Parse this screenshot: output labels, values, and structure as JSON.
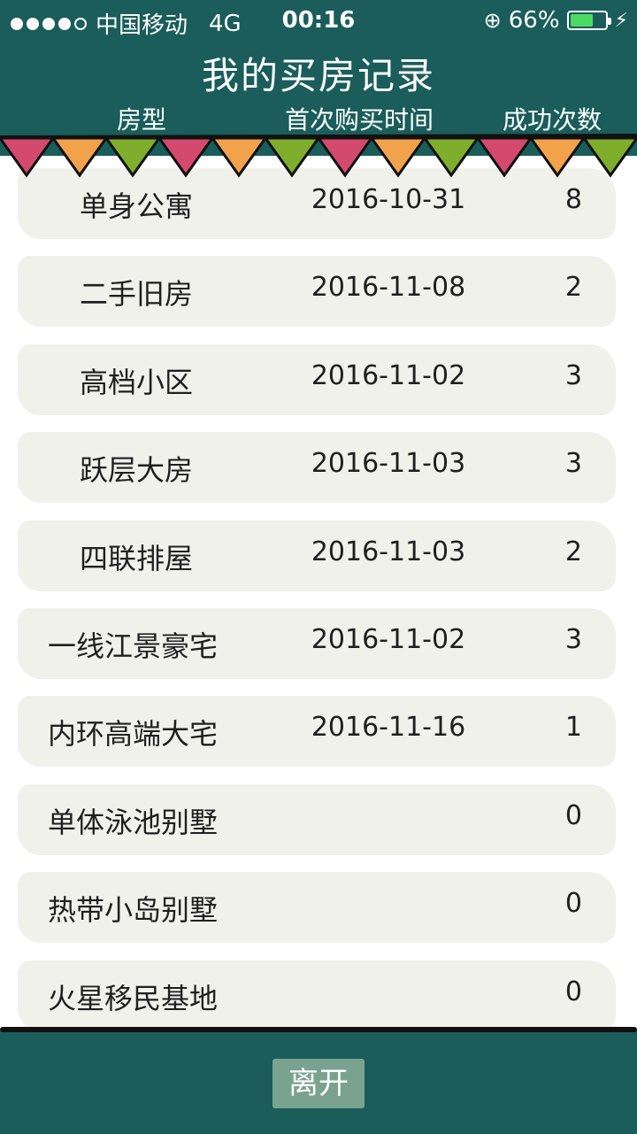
{
  "status_bar": {
    "carrier": "中国移动",
    "network": "4G",
    "time": "00:16",
    "battery_percent_text": "66%",
    "battery_level": 0.66
  },
  "header": {
    "title": "我的买房记录",
    "columns": {
      "type": "房型",
      "first_purchase_time": "首次购买时间",
      "success_count": "成功次数"
    }
  },
  "rows": [
    {
      "name": "单身公寓",
      "time": "2016-10-31",
      "count": "8"
    },
    {
      "name": "二手旧房",
      "time": "2016-11-08",
      "count": "2"
    },
    {
      "name": "高档小区",
      "time": "2016-11-02",
      "count": "3"
    },
    {
      "name": "跃层大房",
      "time": "2016-11-03",
      "count": "3"
    },
    {
      "name": "四联排屋",
      "time": "2016-11-03",
      "count": "2"
    },
    {
      "name": "一线江景豪宅",
      "time": "2016-11-02",
      "count": "3"
    },
    {
      "name": "内环高端大宅",
      "time": "2016-11-16",
      "count": "1"
    },
    {
      "name": "单体泳池别墅",
      "time": "",
      "count": "0"
    },
    {
      "name": "热带小岛别墅",
      "time": "",
      "count": "0"
    },
    {
      "name": "火星移民基地",
      "time": "",
      "count": "0"
    }
  ],
  "footer": {
    "leave_label": "离开"
  },
  "colors": {
    "header_bg": "#1a5d5b",
    "pennant_pink": "#d44a6e",
    "pennant_orange": "#f2a24a",
    "pennant_green": "#7fae2c",
    "button_bg": "#7aa38f"
  }
}
